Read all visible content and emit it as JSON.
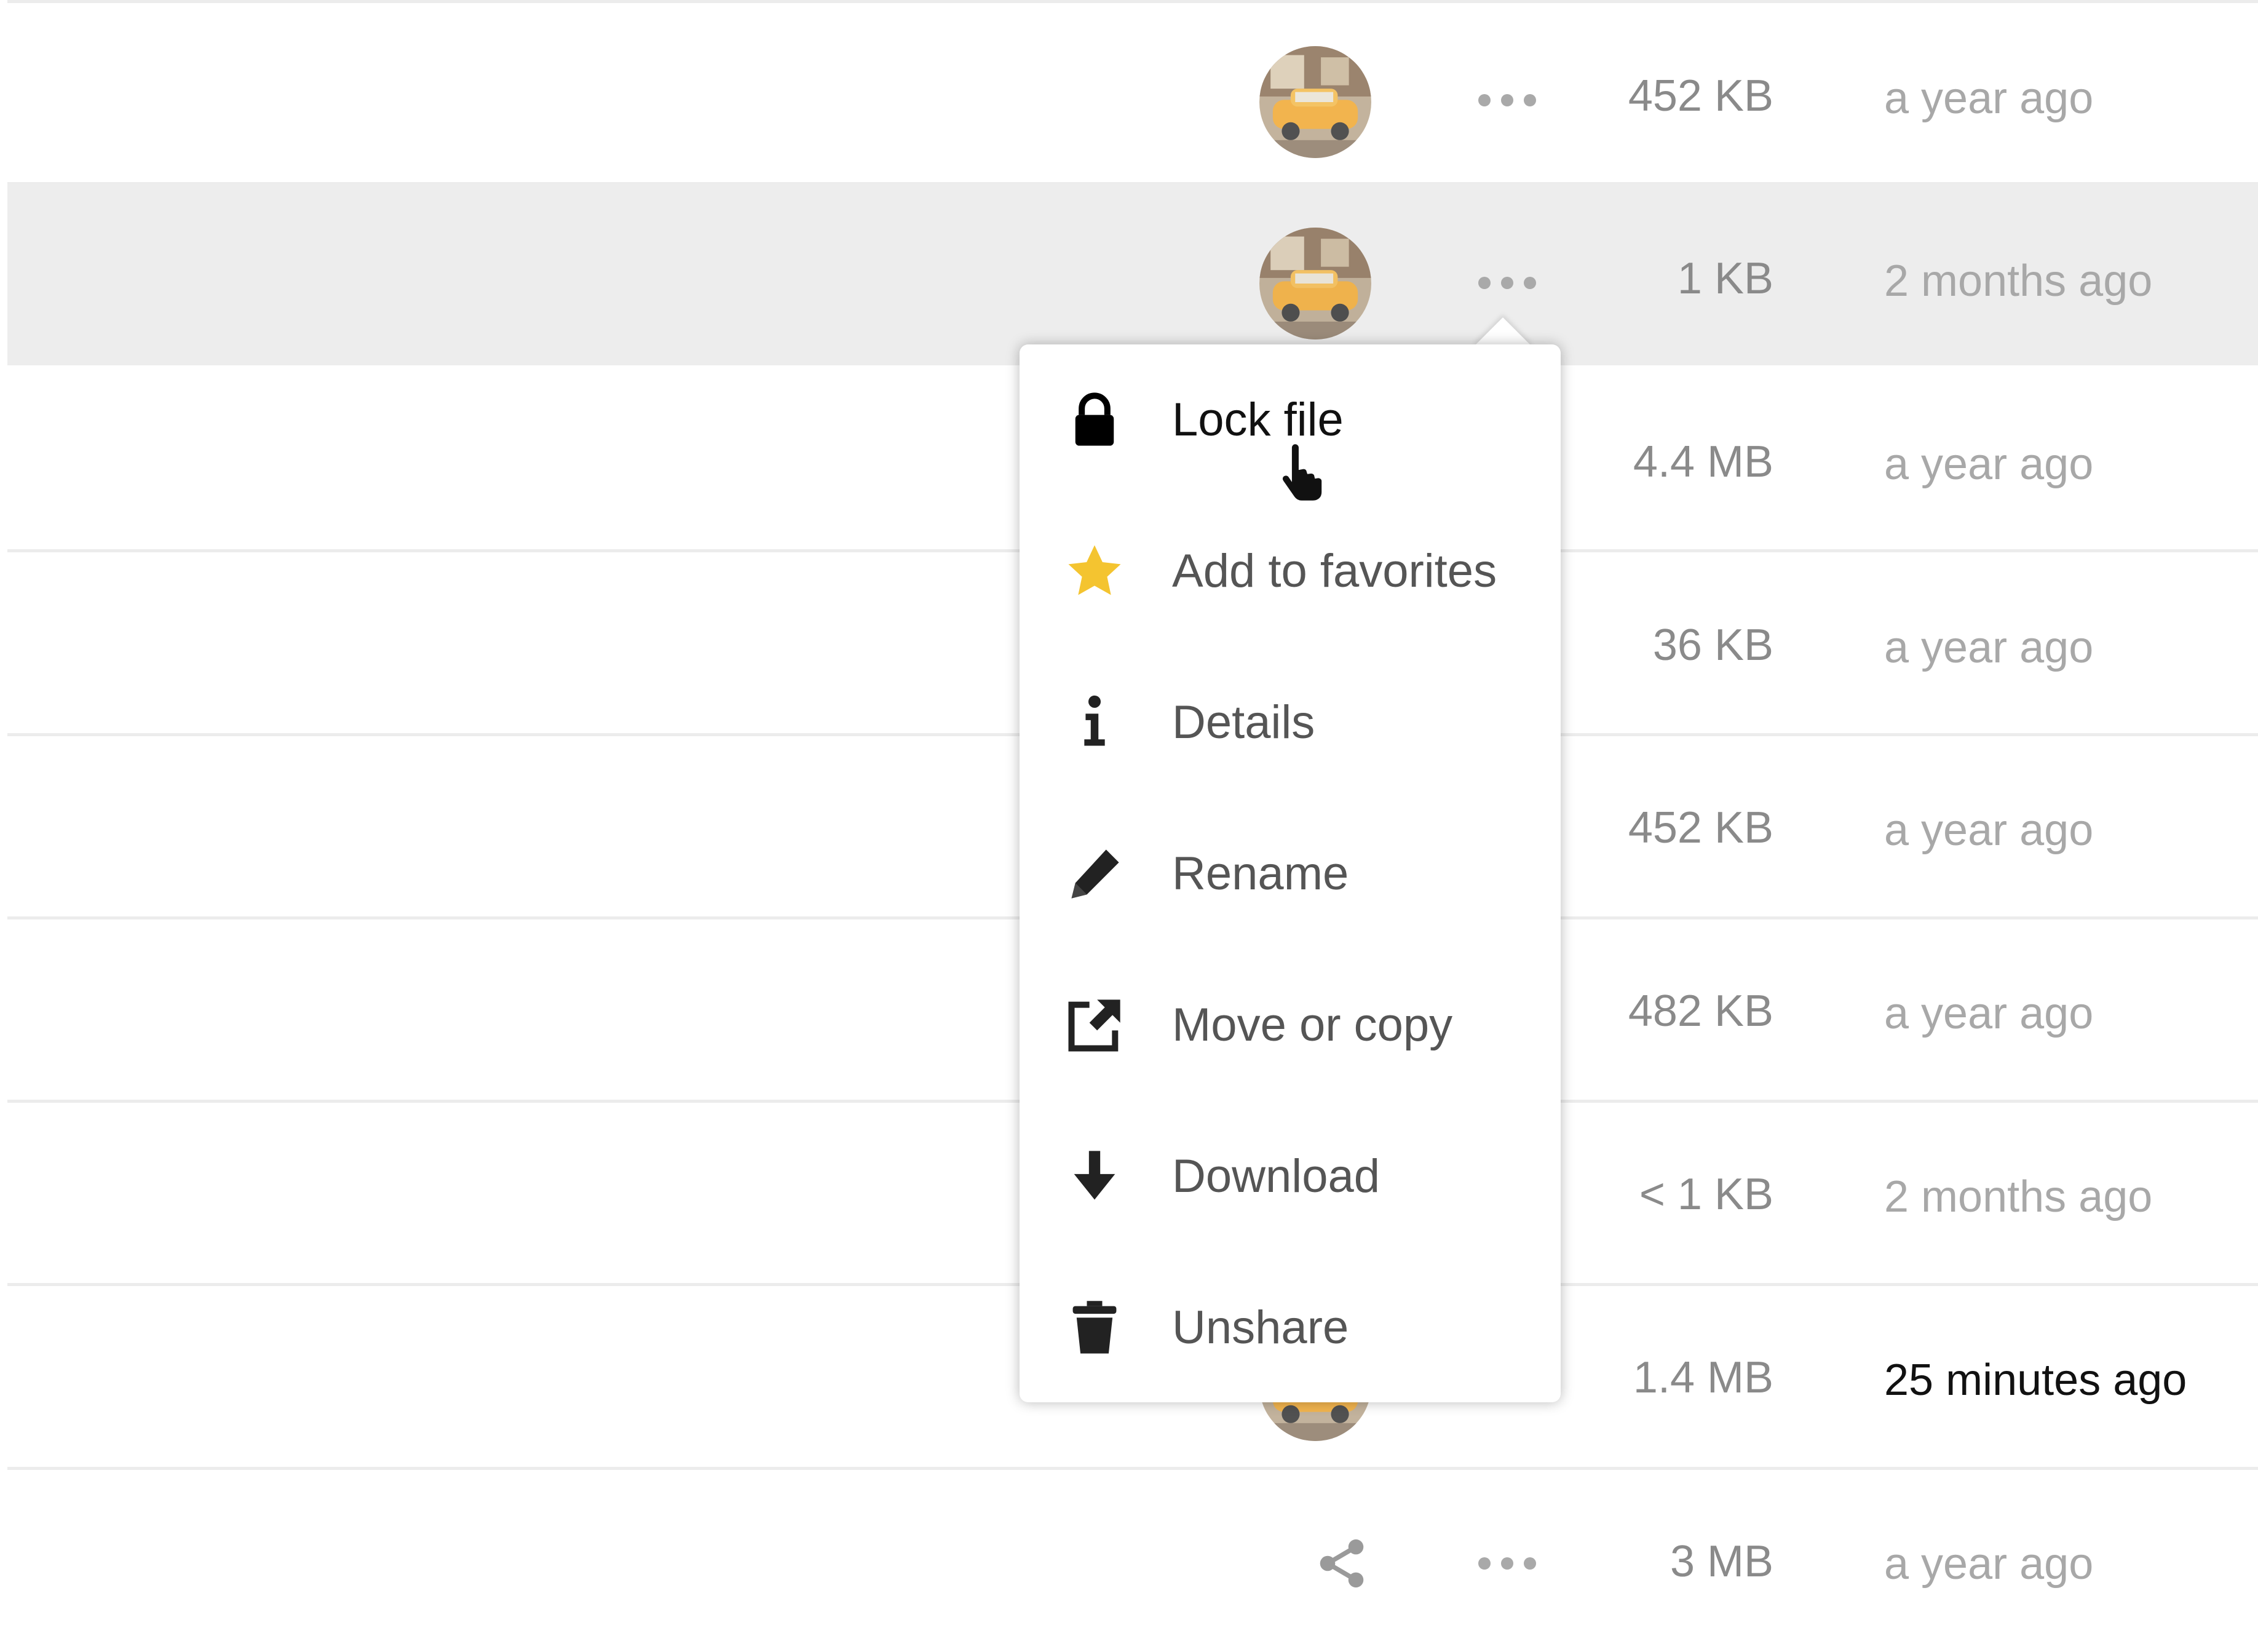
{
  "files": {
    "rows": [
      {
        "size": "452 KB",
        "modified": "a year ago"
      },
      {
        "size": "1 KB",
        "modified": "2 months ago"
      },
      {
        "size": "4.4 MB",
        "modified": "a year ago"
      },
      {
        "size": "36 KB",
        "modified": "a year ago"
      },
      {
        "size": "452 KB",
        "modified": "a year ago"
      },
      {
        "size": "482 KB",
        "modified": "a year ago"
      },
      {
        "size": "< 1 KB",
        "modified": "2 months ago"
      },
      {
        "size": "1.4 MB",
        "modified": "25 minutes ago"
      },
      {
        "size": "3 MB",
        "modified": "a year ago"
      }
    ]
  },
  "context_menu": {
    "items": [
      {
        "label": "Lock file",
        "icon": "lock-icon"
      },
      {
        "label": "Add to favorites",
        "icon": "star-icon"
      },
      {
        "label": "Details",
        "icon": "info-icon"
      },
      {
        "label": "Rename",
        "icon": "pencil-icon"
      },
      {
        "label": "Move or copy",
        "icon": "external-link-icon"
      },
      {
        "label": "Download",
        "icon": "download-arrow-icon"
      },
      {
        "label": "Unshare",
        "icon": "trash-icon"
      }
    ]
  },
  "colors": {
    "highlight_row": "#ededed",
    "star": "#f4c430",
    "muted_text": "#a8a8a8",
    "avatar_car": "#f0a830"
  }
}
